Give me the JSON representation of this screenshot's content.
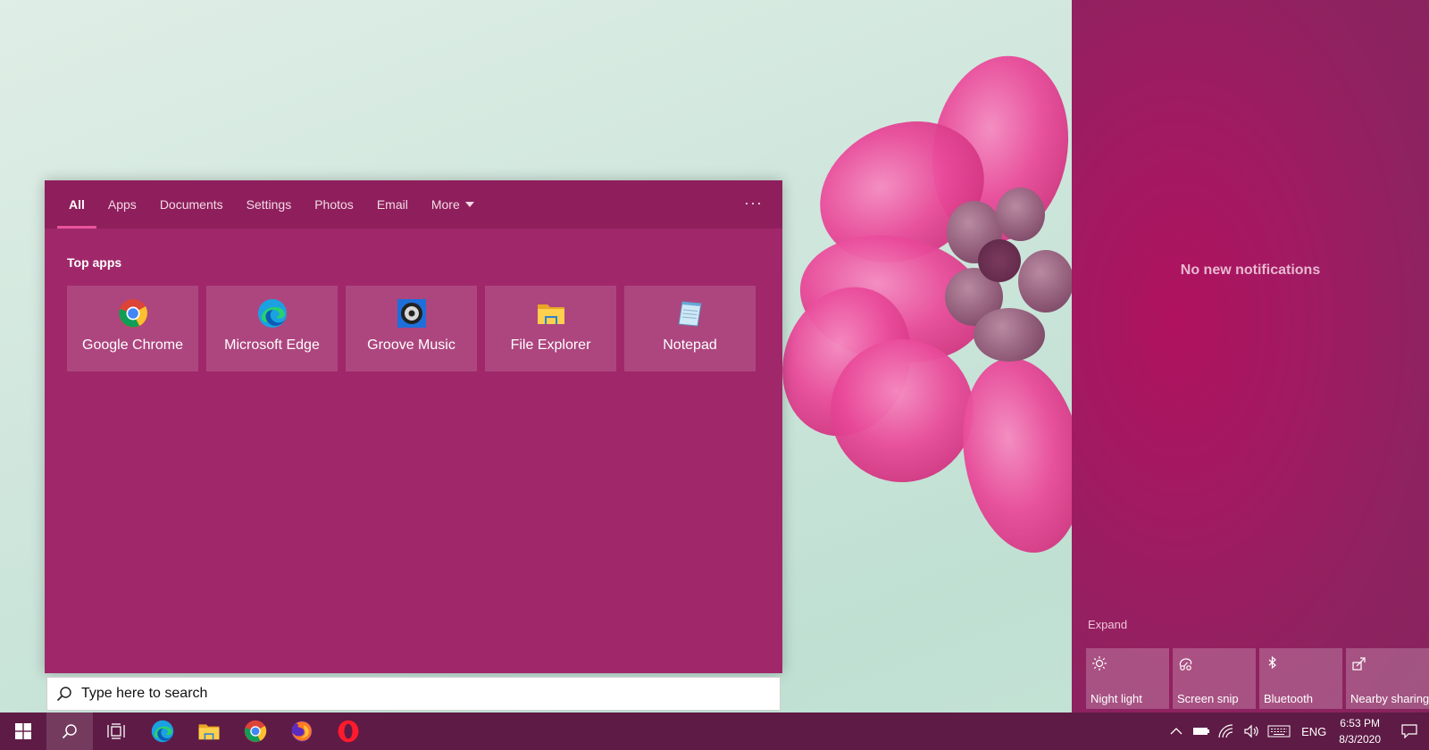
{
  "search": {
    "tabs": [
      {
        "label": "All"
      },
      {
        "label": "Apps"
      },
      {
        "label": "Documents"
      },
      {
        "label": "Settings"
      },
      {
        "label": "Photos"
      },
      {
        "label": "Email"
      },
      {
        "label": "More"
      }
    ],
    "more_options_label": "···",
    "section_title": "Top apps",
    "apps": [
      {
        "name": "Google Chrome",
        "icon": "chrome-icon"
      },
      {
        "name": "Microsoft Edge",
        "icon": "edge-icon"
      },
      {
        "name": "Groove Music",
        "icon": "groove-music-icon"
      },
      {
        "name": "File Explorer",
        "icon": "file-explorer-icon"
      },
      {
        "name": "Notepad",
        "icon": "notepad-icon"
      }
    ],
    "placeholder": "Type here to search"
  },
  "action_center": {
    "no_notifications": "No new notifications",
    "expand_label": "Expand",
    "quick_actions": [
      {
        "label": "Night light",
        "icon": "night-light-icon"
      },
      {
        "label": "Screen snip",
        "icon": "screen-snip-icon"
      },
      {
        "label": "Bluetooth",
        "icon": "bluetooth-icon"
      },
      {
        "label": "Nearby sharing",
        "icon": "nearby-sharing-icon"
      }
    ]
  },
  "taskbar": {
    "pinned": [
      "start-icon",
      "search-icon",
      "task-view-icon",
      "edge-icon",
      "file-explorer-icon",
      "chrome-icon",
      "firefox-icon",
      "opera-icon"
    ],
    "tray": {
      "language": "ENG",
      "time": "6:53 PM",
      "date": "8/3/2020"
    }
  },
  "colors": {
    "accent": "#a0286a",
    "tabs_bar": "#8e1f5c",
    "taskbar": "#5e1b45",
    "active_tab_underline": "#e8559c"
  }
}
